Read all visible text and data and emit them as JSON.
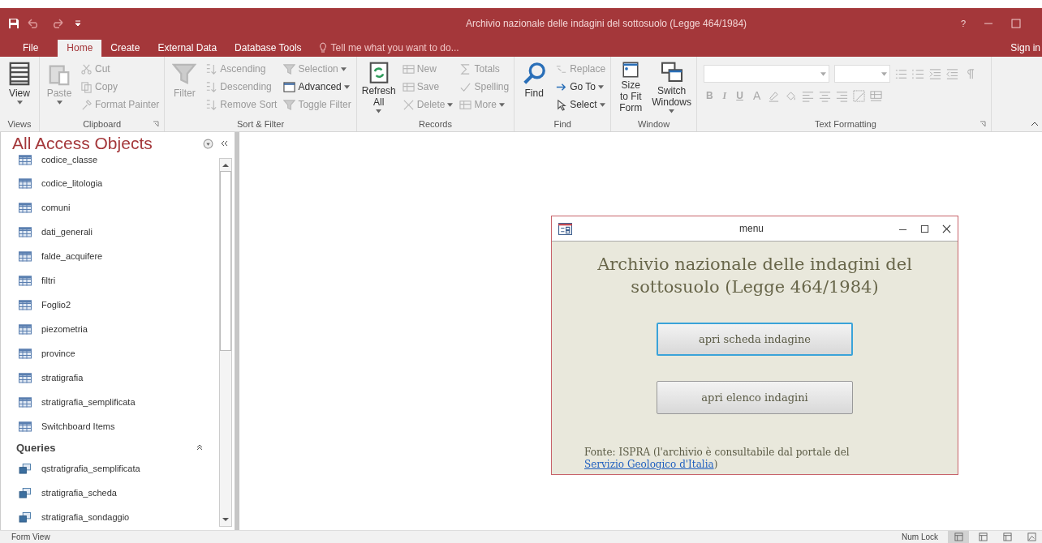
{
  "window": {
    "title": "Archivio nazionale delle indagini del sottosuolo (Legge 464/1984)",
    "help": "?"
  },
  "tabs": [
    {
      "label": "File",
      "selected": false,
      "kind": "file"
    },
    {
      "label": "Home",
      "selected": true,
      "kind": "tab"
    },
    {
      "label": "Create",
      "selected": false,
      "kind": "tab"
    },
    {
      "label": "External Data",
      "selected": false,
      "kind": "tab"
    },
    {
      "label": "Database Tools",
      "selected": false,
      "kind": "tab"
    }
  ],
  "tell_me": {
    "placeholder": "Tell me what you want to do..."
  },
  "sign_in": "Sign in",
  "ribbon": [
    {
      "label": "Views",
      "launcher": false,
      "items": [
        {
          "label": "View",
          "kind": "large",
          "disabled": false,
          "dropdown": true
        }
      ]
    },
    {
      "label": "Clipboard",
      "launcher": true,
      "items": [
        {
          "label": "Paste",
          "kind": "large",
          "disabled": true,
          "dropdown": true
        },
        {
          "label": "Cut",
          "kind": "small",
          "disabled": true,
          "dropdown": false
        },
        {
          "label": "Copy",
          "kind": "small",
          "disabled": true,
          "dropdown": false
        },
        {
          "label": "Format Painter",
          "kind": "small",
          "disabled": true,
          "dropdown": false
        }
      ]
    },
    {
      "label": "Sort & Filter",
      "launcher": false,
      "items": [
        {
          "label": "Filter",
          "kind": "large",
          "disabled": true,
          "dropdown": false
        },
        {
          "label": "Ascending",
          "kind": "small",
          "disabled": true,
          "dropdown": false
        },
        {
          "label": "Descending",
          "kind": "small",
          "disabled": true,
          "dropdown": false
        },
        {
          "label": "Remove Sort",
          "kind": "small",
          "disabled": true,
          "dropdown": false
        },
        {
          "label": "Selection",
          "kind": "small",
          "disabled": true,
          "dropdown": true
        },
        {
          "label": "Advanced",
          "kind": "small",
          "disabled": false,
          "dropdown": true
        },
        {
          "label": "Toggle Filter",
          "kind": "small",
          "disabled": true,
          "dropdown": false
        }
      ]
    },
    {
      "label": "Records",
      "launcher": false,
      "items": [
        {
          "label": "Refresh All",
          "kind": "large",
          "disabled": false,
          "dropdown": true
        },
        {
          "label": "New",
          "kind": "small",
          "disabled": true,
          "dropdown": false
        },
        {
          "label": "Save",
          "kind": "small",
          "disabled": true,
          "dropdown": false
        },
        {
          "label": "Delete",
          "kind": "small",
          "disabled": true,
          "dropdown": true
        },
        {
          "label": "Totals",
          "kind": "small",
          "disabled": true,
          "dropdown": false
        },
        {
          "label": "Spelling",
          "kind": "small",
          "disabled": true,
          "dropdown": false
        },
        {
          "label": "More",
          "kind": "small",
          "disabled": true,
          "dropdown": true
        }
      ]
    },
    {
      "label": "Find",
      "launcher": false,
      "items": [
        {
          "label": "Find",
          "kind": "large",
          "disabled": false,
          "dropdown": false
        },
        {
          "label": "Replace",
          "kind": "small",
          "disabled": true,
          "dropdown": false
        },
        {
          "label": "Go To",
          "kind": "small",
          "disabled": false,
          "dropdown": true
        },
        {
          "label": "Select",
          "kind": "small",
          "disabled": false,
          "dropdown": true
        }
      ]
    },
    {
      "label": "Window",
      "launcher": false,
      "items": [
        {
          "label": "Size to Fit Form",
          "kind": "large",
          "disabled": false,
          "dropdown": false
        },
        {
          "label": "Switch Windows",
          "kind": "large",
          "disabled": false,
          "dropdown": true
        }
      ]
    }
  ],
  "text_formatting": {
    "label": "Text Formatting",
    "launcher": true,
    "buttons": [
      "B",
      "I",
      "U",
      "A"
    ]
  },
  "nav_pane": {
    "title": "All Access Objects",
    "tables": [
      "codice_classe",
      "codice_litologia",
      "comuni",
      "dati_generali",
      "falde_acquifere",
      "filtri",
      "Foglio2",
      "piezometria",
      "province",
      "stratigrafia",
      "stratigrafia_semplificata",
      "Switchboard Items"
    ],
    "queries_header": {
      "label": "Queries",
      "expanded": true
    },
    "queries": [
      "qstratigrafia_semplificata",
      "stratigrafia_scheda",
      "stratigrafia_sondaggio"
    ]
  },
  "form": {
    "title": "menu",
    "heading": "Archivio nazionale delle indagini del sottosuolo (Legge 464/1984)",
    "buttons": [
      {
        "label": "apri scheda indagine",
        "focused": true
      },
      {
        "label": "apri elenco indagini",
        "focused": false
      }
    ],
    "note": "Fonte: ISPRA (l'archivio è consultabile dal portale del",
    "link": "Servizio Geologico d'Italia",
    "note_end": ")"
  },
  "status_bar": {
    "left": "Form View",
    "num_lock": "Num Lock",
    "views": [
      {
        "selected": true
      },
      {
        "selected": false
      },
      {
        "selected": false
      },
      {
        "selected": false
      }
    ]
  }
}
